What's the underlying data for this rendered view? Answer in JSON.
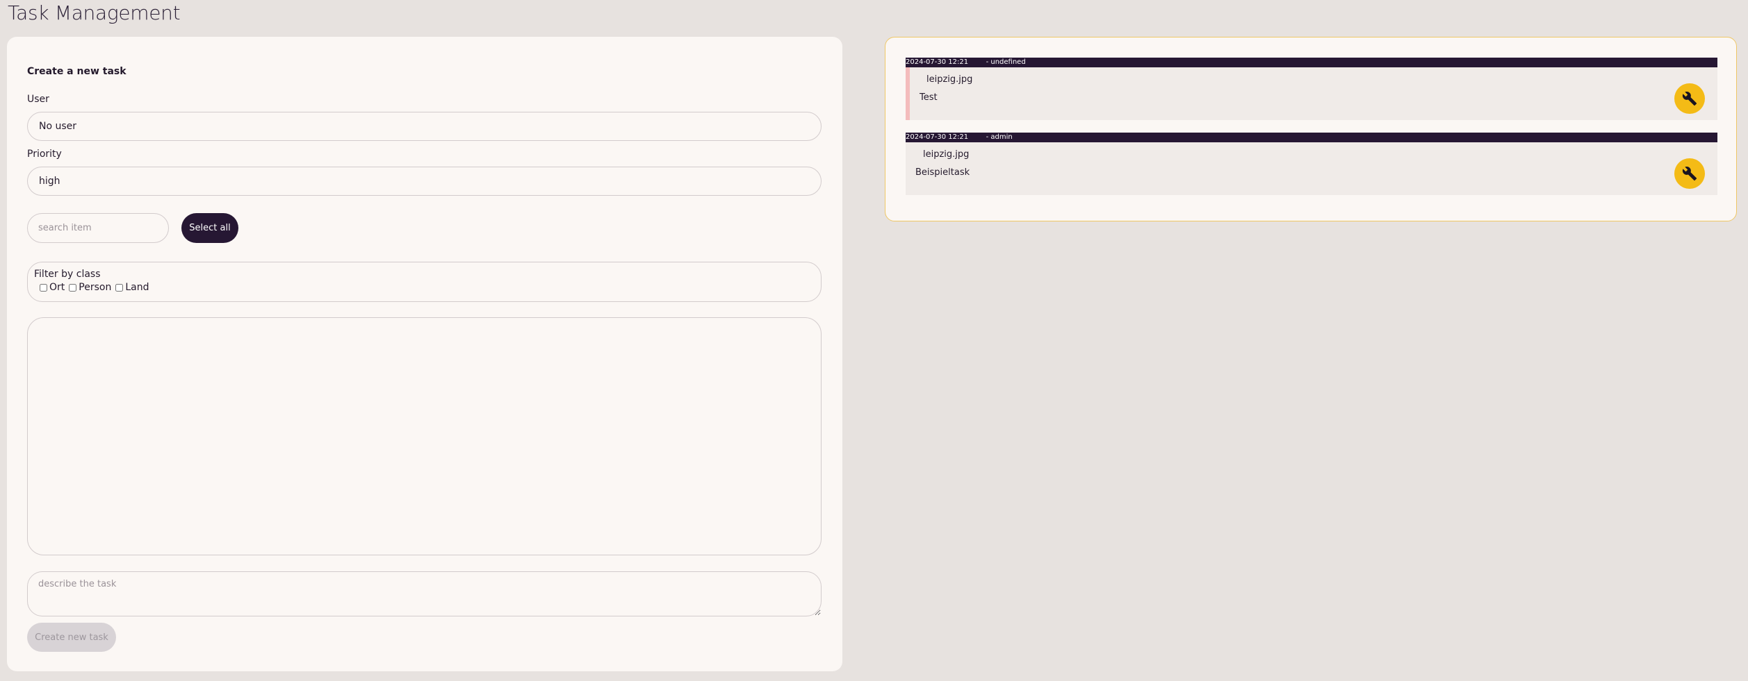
{
  "page_title": "Task Management",
  "form": {
    "heading": "Create a new task",
    "user_label": "User",
    "user_value": "No user",
    "priority_label": "Priority",
    "priority_value": "high",
    "search_placeholder": "search item",
    "select_all_label": "Select all",
    "filter_title": "Filter by class",
    "filter_options": [
      "Ort",
      "Person",
      "Land"
    ],
    "description_placeholder": "describe the task",
    "create_label": "Create new task"
  },
  "tasks": [
    {
      "date": "2024-07-30 12:21",
      "user": "- undefined",
      "file": "leipzig.jpg",
      "description": "Test",
      "edit_icon": "wrench-icon"
    },
    {
      "date": "2024-07-30 12:21",
      "user": "- admin",
      "file": "leipzig.jpg",
      "description": "Beispieltask",
      "edit_icon": "wrench-icon"
    }
  ],
  "colors": {
    "background": "#e7e2df",
    "panel": "#fbf7f4",
    "accent_dark": "#261733",
    "accent_yellow": "#f4bb16",
    "right_panel_border": "#efc766",
    "marker_pink": "#f4bcbc"
  }
}
